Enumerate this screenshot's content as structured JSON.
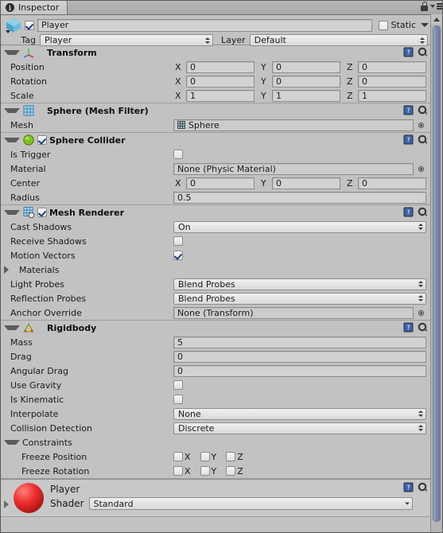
{
  "window": {
    "tab_label": "Inspector",
    "tab_icon": "info-circle-icon",
    "lock_icon": "lock-icon",
    "menu_icon": "hamburger-menu-icon"
  },
  "object_header": {
    "icon": "cube-gameobject-icon",
    "enabled": true,
    "name": "Player",
    "static_label": "Static",
    "static_checked": false,
    "tag_label": "Tag",
    "tag_value": "Player",
    "layer_label": "Layer",
    "layer_value": "Default"
  },
  "components": [
    {
      "title": "Transform",
      "icon": "transform-axis-icon",
      "expanded": true,
      "has_enable_checkbox": false,
      "rows": [
        {
          "type": "vector3",
          "label": "Position",
          "axes": [
            "X",
            "Y",
            "Z"
          ],
          "values": [
            "0",
            "0",
            "0"
          ]
        },
        {
          "type": "vector3",
          "label": "Rotation",
          "axes": [
            "X",
            "Y",
            "Z"
          ],
          "values": [
            "0",
            "0",
            "0"
          ]
        },
        {
          "type": "vector3",
          "label": "Scale",
          "axes": [
            "X",
            "Y",
            "Z"
          ],
          "values": [
            "1",
            "1",
            "1"
          ]
        }
      ]
    },
    {
      "title": "Sphere (Mesh Filter)",
      "icon": "mesh-filter-grid-icon",
      "expanded": true,
      "has_enable_checkbox": false,
      "rows": [
        {
          "type": "object",
          "label": "Mesh",
          "value": "Sphere",
          "value_icon": "mesh-mini-icon"
        }
      ]
    },
    {
      "title": "Sphere Collider",
      "icon": "sphere-collider-icon",
      "expanded": true,
      "has_enable_checkbox": true,
      "enabled": true,
      "rows": [
        {
          "type": "checkbox",
          "label": "Is Trigger",
          "checked": false
        },
        {
          "type": "object",
          "label": "Material",
          "value": "None (Physic Material)"
        },
        {
          "type": "vector3",
          "label": "Center",
          "axes": [
            "X",
            "Y",
            "Z"
          ],
          "values": [
            "0",
            "0",
            "0"
          ]
        },
        {
          "type": "text",
          "label": "Radius",
          "value": "0.5"
        }
      ]
    },
    {
      "title": "Mesh Renderer",
      "icon": "mesh-renderer-icon",
      "expanded": true,
      "has_enable_checkbox": true,
      "enabled": true,
      "rows": [
        {
          "type": "popup",
          "label": "Cast Shadows",
          "value": "On"
        },
        {
          "type": "checkbox",
          "label": "Receive Shadows",
          "checked": false
        },
        {
          "type": "checkbox",
          "label": "Motion Vectors",
          "checked": true
        },
        {
          "type": "foldout",
          "label": "Materials",
          "expanded": false
        },
        {
          "type": "popup",
          "label": "Light Probes",
          "value": "Blend Probes"
        },
        {
          "type": "popup",
          "label": "Reflection Probes",
          "value": "Blend Probes"
        },
        {
          "type": "object",
          "label": "Anchor Override",
          "value": "None (Transform)"
        }
      ]
    },
    {
      "title": "Rigidbody",
      "icon": "rigidbody-icon",
      "expanded": true,
      "has_enable_checkbox": false,
      "rows": [
        {
          "type": "text",
          "label": "Mass",
          "value": "5"
        },
        {
          "type": "text",
          "label": "Drag",
          "value": "0"
        },
        {
          "type": "text",
          "label": "Angular Drag",
          "value": "0"
        },
        {
          "type": "checkbox",
          "label": "Use Gravity",
          "checked": false
        },
        {
          "type": "checkbox",
          "label": "Is Kinematic",
          "checked": false
        },
        {
          "type": "popup",
          "label": "Interpolate",
          "value": "None"
        },
        {
          "type": "popup",
          "label": "Collision Detection",
          "value": "Discrete"
        },
        {
          "type": "foldout",
          "label": "Constraints",
          "expanded": true
        },
        {
          "type": "axis-checkboxes",
          "label": "Freeze Position",
          "axes": [
            "X",
            "Y",
            "Z"
          ],
          "checked": [
            false,
            false,
            false
          ]
        },
        {
          "type": "axis-checkboxes",
          "label": "Freeze Rotation",
          "axes": [
            "X",
            "Y",
            "Z"
          ],
          "checked": [
            false,
            false,
            false
          ]
        }
      ]
    }
  ],
  "material_preview": {
    "name": "Player",
    "shader_label": "Shader",
    "shader_value": "Standard",
    "sphere_color": "#e02626",
    "expanded": false
  },
  "colors": {
    "panel_bg": "#c2c2c2",
    "field_bg": "#d2d2d2",
    "popup_bg": "#e9e9e9",
    "border": "#8d8d8d",
    "text": "#1a1a1a",
    "scrollbar_thumb": "#7d8cae",
    "checkmark": "#1d3f82"
  }
}
